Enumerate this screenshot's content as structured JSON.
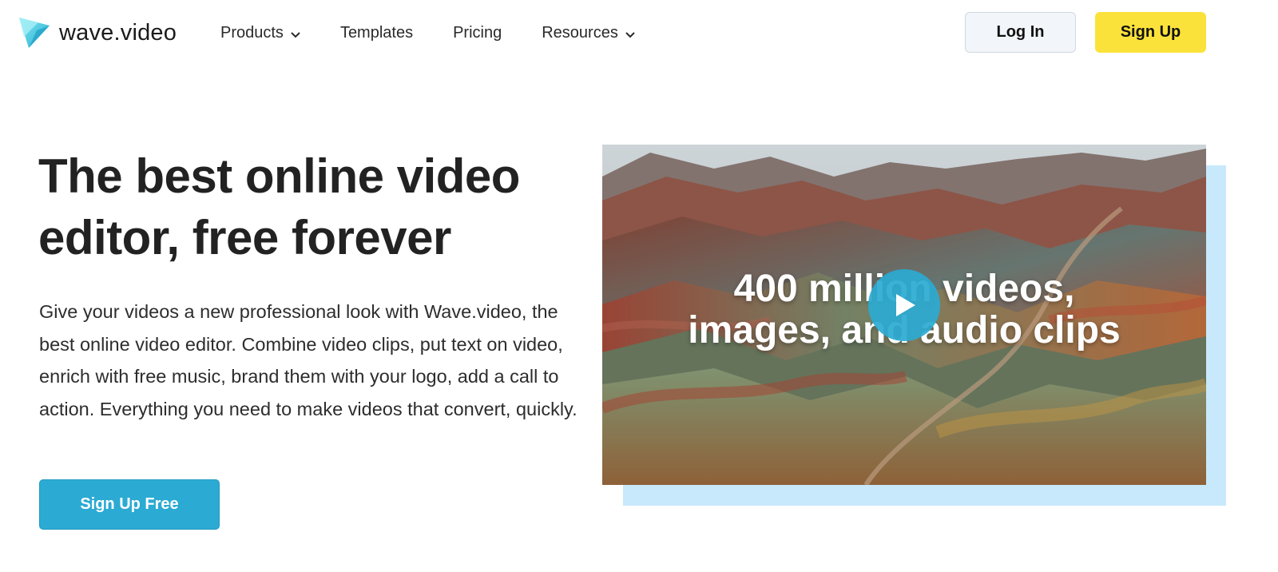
{
  "brand": {
    "name": "wave.video",
    "logo_icon": "wave-triangle-logo"
  },
  "nav": {
    "items": [
      {
        "label": "Products",
        "has_dropdown": true
      },
      {
        "label": "Templates",
        "has_dropdown": false
      },
      {
        "label": "Pricing",
        "has_dropdown": false
      },
      {
        "label": "Resources",
        "has_dropdown": true
      }
    ],
    "login_label": "Log In",
    "signup_label": "Sign Up"
  },
  "hero": {
    "title_line1": "The best online video",
    "title_line2": "editor, free forever",
    "description": "Give your videos a new professional look with Wave.video, the best online video editor. Combine video clips, put text on video, enrich with free music, brand them with your logo, add a call to action. Everything you need to make videos that convert, quickly.",
    "cta_label": "Sign Up Free"
  },
  "video": {
    "caption_line1": "400 million videos,",
    "caption_line2": "images, and audio clips",
    "play_icon": "play-icon"
  },
  "colors": {
    "accent": "#2baad3",
    "signup": "#fbe23b",
    "media_shadow": "#c8e9fb"
  }
}
